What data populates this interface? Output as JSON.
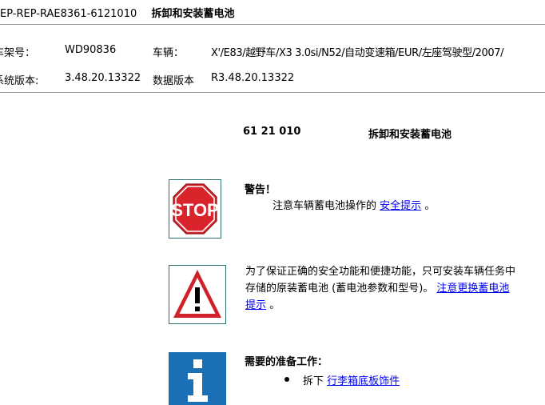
{
  "header": {
    "doc_title_code": "EP-REP-RAE8361-6121010",
    "doc_title_text": "拆卸和安装蓄电池",
    "chassis_label": "车架号：",
    "chassis_value": "WD90836",
    "vehicle_label": "车辆：",
    "vehicle_value": "X'/E83/越野车/X3 3.0si/N52/自动变速箱/EUR/左座驾驶型/2007/",
    "system_version_label": "系统版本:",
    "system_version_value": "3.48.20.13322",
    "data_version_label": "数据版本",
    "data_version_value": "R3.48.20.13322"
  },
  "section": {
    "number": "61 21 010",
    "title": "拆卸和安装蓄电池"
  },
  "warning": {
    "icon": "stop-sign-icon",
    "stop_text": "STOP",
    "heading": "警告！",
    "text_before": "注意车辆蓄电池操作的",
    "link": "安全提示",
    "text_after": "。"
  },
  "caution": {
    "icon": "warning-triangle-icon",
    "line1": "为了保证正确的安全功能和便捷功能，只可安装车辆任务中",
    "line2_before": "存储的原装蓄电池 (蓄电池参数和型号)。",
    "link_part1": "注意更换蓄电池",
    "link_part2": "提示",
    "text_after": "。"
  },
  "prep": {
    "icon": "info-icon",
    "heading": "需要的准备工作：",
    "items": [
      {
        "prefix": "拆下",
        "link": "行李箱底板饰件"
      }
    ]
  },
  "colors": {
    "stop_red": "#d9242b",
    "warning_border": "#d0202a",
    "info_blue": "#1a6fb5",
    "link": "#0000ee",
    "rule": "#9a9a9a"
  }
}
